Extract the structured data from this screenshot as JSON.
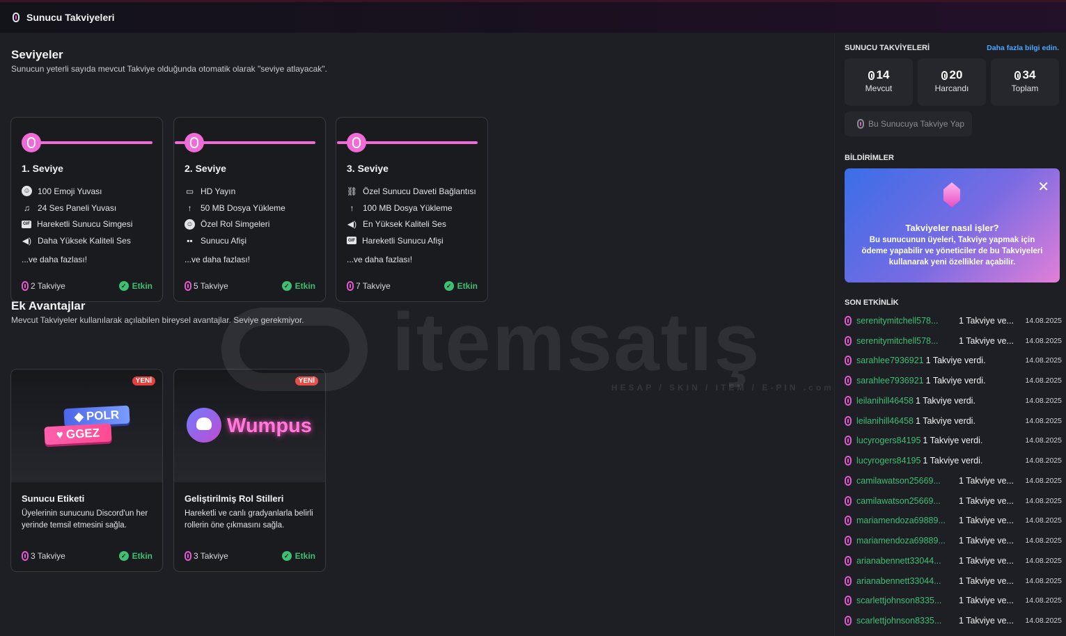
{
  "titlebar": {
    "title": "Sunucu Takviyeleri"
  },
  "levels_section": {
    "title": "Seviyeler",
    "subtitle": "Sunucun yeterli sayıda mevcut Takviye olduğunda otomatik olarak \"seviye atlayacak\"."
  },
  "levels": [
    {
      "name": "1. Seviye",
      "features": [
        {
          "icon": "emoji-icon",
          "label": "100 Emoji Yuvası"
        },
        {
          "icon": "soundboard-icon",
          "label": "24 Ses Paneli Yuvası"
        },
        {
          "icon": "gif-icon",
          "label": "Hareketli Sunucu Simgesi"
        },
        {
          "icon": "speaker-icon",
          "label": "Daha Yüksek Kaliteli Ses"
        }
      ],
      "more": "...ve daha fazlası!",
      "count": "2 Takviye",
      "status": "Etkin"
    },
    {
      "name": "2. Seviye",
      "features": [
        {
          "icon": "screen-share-icon",
          "label": "HD Yayın"
        },
        {
          "icon": "upload-icon",
          "label": "50 MB Dosya Yükleme"
        },
        {
          "icon": "emoji-icon",
          "label": "Özel Rol Simgeleri"
        },
        {
          "icon": "banner-icon",
          "label": "Sunucu Afişi"
        }
      ],
      "more": "...ve daha fazlası!",
      "count": "5 Takviye",
      "status": "Etkin"
    },
    {
      "name": "3. Seviye",
      "features": [
        {
          "icon": "link-icon",
          "label": "Özel Sunucu Daveti Bağlantısı"
        },
        {
          "icon": "upload-icon",
          "label": "100 MB Dosya Yükleme"
        },
        {
          "icon": "speaker-icon",
          "label": "En Yüksek Kaliteli Ses"
        },
        {
          "icon": "gif-icon",
          "label": "Hareketli Sunucu Afişi"
        }
      ],
      "more": "...ve daha fazlası!",
      "count": "7 Takviye",
      "status": "Etkin"
    }
  ],
  "perks_section": {
    "title": "Ek Avantajlar",
    "subtitle": "Mevcut Takviyeler kullanılarak açılabilen bireysel avantajlar. Seviye gerekmiyor."
  },
  "perks": [
    {
      "badge": "YENİ",
      "tag_top": "POLR",
      "tag_bottom": "GGEZ",
      "title": "Sunucu Etiketi",
      "desc": "Üyelerinin sunucunu Discord'un her yerinde temsil etmesini sağla.",
      "count": "3 Takviye",
      "status": "Etkin"
    },
    {
      "badge": "YENİ",
      "art_text": "Wumpus",
      "title": "Geliştirilmiş Rol Stilleri",
      "desc": "Hareketli ve canlı gradyanlarla belirli rollerin öne çıkmasını sağla.",
      "count": "3 Takviye",
      "status": "Etkin"
    }
  ],
  "watermark": {
    "brand": "itemsatış",
    "tagline": "HESAP / SKIN / ITEM / E-PIN",
    "domain": ".com"
  },
  "sidebar": {
    "boosts_title": "SUNUCU TAKVİYELERİ",
    "learn_more": "Daha fazla bilgi edin.",
    "stats": [
      {
        "value": "14",
        "label": "Mevcut"
      },
      {
        "value": "20",
        "label": "Harcandı"
      },
      {
        "value": "34",
        "label": "Toplam"
      }
    ],
    "boost_button": "Bu Sunucuya Takviye Yap",
    "notifications_title": "BİLDİRİMLER",
    "notification": {
      "title": "Takviyeler nasıl işler?",
      "body": "Bu sunucunun üyeleri, Takviye yapmak için ödeme yapabilir ve yöneticiler de bu Takviyeleri kullanarak yeni özellikler açabilir."
    },
    "activity_title": "SON ETKİNLİK",
    "activity": [
      {
        "user": "serenitymitchell578...",
        "msg": "1 Takviye ve...",
        "date": "14.08.2025"
      },
      {
        "user": "serenitymitchell578...",
        "msg": "1 Takviye ve...",
        "date": "14.08.2025"
      },
      {
        "user": "sarahlee7936921",
        "msg": "1 Takviye verdi.",
        "date": "14.08.2025"
      },
      {
        "user": "sarahlee7936921",
        "msg": "1 Takviye verdi.",
        "date": "14.08.2025"
      },
      {
        "user": "leilanihill46458",
        "msg": "1 Takviye verdi.",
        "date": "14.08.2025"
      },
      {
        "user": "leilanihill46458",
        "msg": "1 Takviye verdi.",
        "date": "14.08.2025"
      },
      {
        "user": "lucyrogers84195",
        "msg": "1 Takviye verdi.",
        "date": "14.08.2025"
      },
      {
        "user": "lucyrogers84195",
        "msg": "1 Takviye verdi.",
        "date": "14.08.2025"
      },
      {
        "user": "camilawatson25669...",
        "msg": "1 Takviye ve...",
        "date": "14.08.2025"
      },
      {
        "user": "camilawatson25669...",
        "msg": "1 Takviye ve...",
        "date": "14.08.2025"
      },
      {
        "user": "mariamendoza69889...",
        "msg": "1 Takviye ve...",
        "date": "14.08.2025"
      },
      {
        "user": "mariamendoza69889...",
        "msg": "1 Takviye ve...",
        "date": "14.08.2025"
      },
      {
        "user": "arianabennett33044...",
        "msg": "1 Takviye ve...",
        "date": "14.08.2025"
      },
      {
        "user": "arianabennett33044...",
        "msg": "1 Takviye ve...",
        "date": "14.08.2025"
      },
      {
        "user": "scarlettjohnson8335...",
        "msg": "1 Takviye ve...",
        "date": "14.08.2025"
      },
      {
        "user": "scarlettjohnson8335...",
        "msg": "1 Takviye ve...",
        "date": "14.08.2025"
      }
    ]
  }
}
